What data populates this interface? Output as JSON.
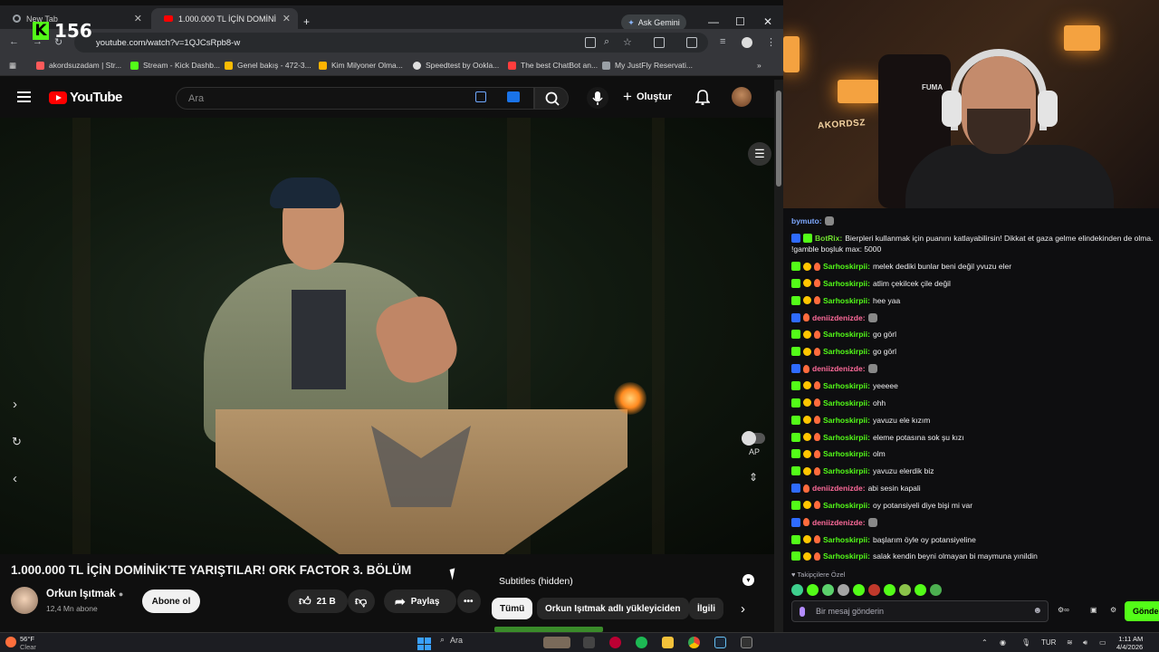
{
  "browser": {
    "tabs": [
      {
        "label": "New Tab"
      },
      {
        "label": "1.000.000 TL İÇİN DOMİNİ"
      }
    ],
    "ask_gemini": "Ask Gemini",
    "url": "youtube.com/watch?v=1QJCsRpb8-w",
    "bookmarks": [
      {
        "label": "akordsuzadam | Str...",
        "icon_color": "#ff5a5a"
      },
      {
        "label": "Stream - Kick Dashb...",
        "icon_color": "#53fc18"
      },
      {
        "label": "Genel bakış - 472-3...",
        "icon_color": "#fbbc04"
      },
      {
        "label": "Kim Milyoner Olma...",
        "icon_color": "#ffb300"
      },
      {
        "label": "Speedtest by Ookla...",
        "icon_color": "#e0e0e0"
      },
      {
        "label": "The best ChatBot an...",
        "icon_color": "#ff3d3d"
      },
      {
        "label": "My JustFly Reservati...",
        "icon_color": "#9aa0a6"
      }
    ]
  },
  "kick_overlay": {
    "count": "156"
  },
  "youtube": {
    "logo": "YouTube",
    "search_placeholder": "Ara",
    "create_label": "Oluştur",
    "video": {
      "ap_label": "AP"
    },
    "title": "1.000.000 TL İÇİN DOMİNİK'TE YARIŞTILAR! ORK FACTOR 3. BÖLÜM",
    "channel": {
      "name": "Orkun Işıtmak",
      "subs": "12,4 Mn abone",
      "subscribe_label": "Abone ol"
    },
    "likes": "21 B",
    "share_label": "Paylaş",
    "subtitles_label": "Subtitles (hidden)",
    "chips": [
      "Tümü",
      "Orkun Işıtmak adlı yükleyiciden",
      "İlgili"
    ]
  },
  "chat": {
    "top_user": "bymuto:",
    "messages": [
      {
        "user": "BotRix:",
        "text": "Bierpleri kullanmak için puanını katlayabilirsin! Dikkat et gaza gelme elindekinden de olma.",
        "cont": "!gamble boşluk max: 5000",
        "color": "lime"
      },
      {
        "user": "Sarhoskirpii:",
        "text": "melek dediki bunlar beni değil yvuzu eler",
        "color": "green"
      },
      {
        "user": "Sarhoskirpii:",
        "text": "atlim çekilcek çile değil",
        "color": "green"
      },
      {
        "user": "Sarhoskirpii:",
        "text": "hee yaa",
        "color": "green"
      },
      {
        "user": "deniizdenizde:",
        "text": "",
        "color": "pink"
      },
      {
        "user": "Sarhoskirpii:",
        "text": "go görl",
        "color": "green"
      },
      {
        "user": "Sarhoskirpii:",
        "text": "go görl",
        "color": "green"
      },
      {
        "user": "deniizdenizde:",
        "text": "",
        "color": "pink"
      },
      {
        "user": "Sarhoskirpii:",
        "text": "yeeeee",
        "color": "green"
      },
      {
        "user": "Sarhoskirpii:",
        "text": "ohh",
        "color": "green"
      },
      {
        "user": "Sarhoskirpii:",
        "text": "yavuzu ele kızım",
        "color": "green"
      },
      {
        "user": "Sarhoskirpii:",
        "text": "eleme potasına sok şu kızı",
        "color": "green"
      },
      {
        "user": "Sarhoskirpii:",
        "text": "olm",
        "color": "green"
      },
      {
        "user": "Sarhoskirpii:",
        "text": "yavuzu elerdik biz",
        "color": "green"
      },
      {
        "user": "deniizdenizde:",
        "text": "abi sesin kapali",
        "color": "pink"
      },
      {
        "user": "Sarhoskirpii:",
        "text": "oy potansiyeli diye bişi mi var",
        "color": "green"
      },
      {
        "user": "deniizdenizde:",
        "text": "",
        "color": "pink"
      },
      {
        "user": "Sarhoskirpii:",
        "text": "başlarım öyle oy potansiyeline",
        "color": "green"
      },
      {
        "user": "Sarhoskirpii:",
        "text": "salak kendin beyni olmayan bi maymuna yınildin",
        "color": "green"
      }
    ],
    "followers_label": "Takipçilere Özel",
    "input_placeholder": "Bir mesaj gönderin",
    "send_label": "Gönder"
  },
  "stream_cam": {
    "sign": "AKORDSZ",
    "chair_brand": "FUMA"
  },
  "taskbar": {
    "weather_temp": "56°F",
    "weather_desc": "Clear",
    "search_label": "Ara",
    "lang": "TUR",
    "time": "1:11 AM",
    "date": "4/4/2026"
  }
}
